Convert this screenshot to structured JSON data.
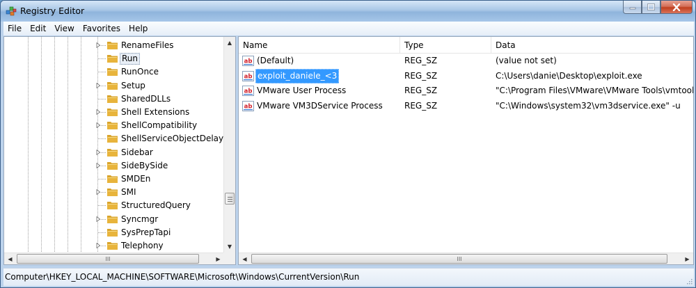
{
  "window": {
    "title": "Registry Editor",
    "icon": "registry-editor-icon",
    "controls": [
      "minimize-icon",
      "maximize-icon",
      "close-icon"
    ]
  },
  "menu": [
    "File",
    "Edit",
    "View",
    "Favorites",
    "Help"
  ],
  "tree": {
    "items": [
      {
        "label": "RenameFiles",
        "expandable": true
      },
      {
        "label": "Run",
        "expandable": false,
        "selected": true
      },
      {
        "label": "RunOnce",
        "expandable": false
      },
      {
        "label": "Setup",
        "expandable": true
      },
      {
        "label": "SharedDLLs",
        "expandable": false
      },
      {
        "label": "Shell Extensions",
        "expandable": true
      },
      {
        "label": "ShellCompatibility",
        "expandable": true
      },
      {
        "label": "ShellServiceObjectDelayL",
        "expandable": false
      },
      {
        "label": "Sidebar",
        "expandable": true
      },
      {
        "label": "SideBySide",
        "expandable": true
      },
      {
        "label": "SMDEn",
        "expandable": false
      },
      {
        "label": "SMI",
        "expandable": true
      },
      {
        "label": "StructuredQuery",
        "expandable": false
      },
      {
        "label": "Syncmgr",
        "expandable": true
      },
      {
        "label": "SysPrepTapi",
        "expandable": false
      },
      {
        "label": "Telephony",
        "expandable": true
      }
    ],
    "hscroll_thumb_glyph": "III"
  },
  "list": {
    "columns": {
      "name": "Name",
      "type": "Type",
      "data": "Data"
    },
    "rows": [
      {
        "name": "(Default)",
        "type": "REG_SZ",
        "data": "(value not set)",
        "selected": false
      },
      {
        "name": "exploit_daniele_<3",
        "type": "REG_SZ",
        "data": "C:\\Users\\danie\\Desktop\\exploit.exe",
        "selected": true
      },
      {
        "name": "VMware User Process",
        "type": "REG_SZ",
        "data": "\"C:\\Program Files\\VMware\\VMware Tools\\vmtoolsd.exe\" -n vmusr",
        "selected": false
      },
      {
        "name": "VMware VM3DService Process",
        "type": "REG_SZ",
        "data": "\"C:\\Windows\\system32\\vm3dservice.exe\" -u",
        "selected": false
      }
    ],
    "value_icon": "string-value-icon",
    "hscroll_thumb_glyph": "III"
  },
  "status": {
    "path": "Computer\\HKEY_LOCAL_MACHINE\\SOFTWARE\\Microsoft\\Windows\\CurrentVersion\\Run"
  },
  "colors": {
    "selection": "#3399ff",
    "folder": "#e8b43c"
  }
}
